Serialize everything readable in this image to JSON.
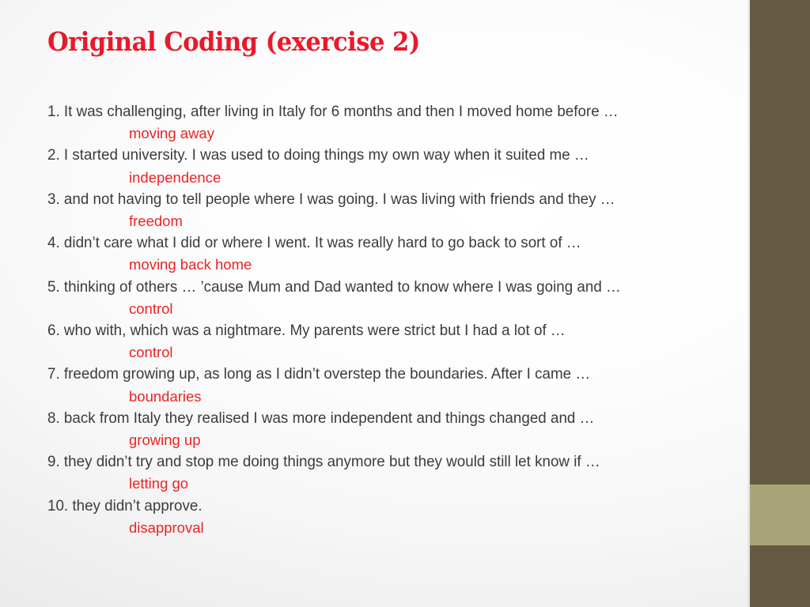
{
  "slide": {
    "title": "Original Coding (exercise 2)",
    "colors": {
      "title_red": "#e8192b",
      "code_red": "#ee2222",
      "body_text": "#3b3b3b",
      "band_dark": "#655b44",
      "band_accent": "#a9a378"
    }
  },
  "entries": [
    {
      "statement": "1. It was challenging, after living in Italy for 6 months and then I moved home before …",
      "code": "moving away"
    },
    {
      "statement": "2. I started university. I was used to doing things my own way when it suited me …",
      "code": "independence"
    },
    {
      "statement": "3. and not having to tell people where I was going. I was living with friends and they …",
      "code": "freedom"
    },
    {
      "statement": "4. didn’t care what I did or where I went. It was really hard to go back to sort of …",
      "code": "moving back home"
    },
    {
      "statement": "5. thinking of others … ’cause Mum and Dad wanted to know where I was going and …",
      "code": "control"
    },
    {
      "statement": "6. who with, which was a nightmare. My parents were strict but I had a lot of …",
      "code": "control"
    },
    {
      "statement": "7. freedom growing up, as long as I didn’t overstep the boundaries. After I came …",
      "code": "boundaries"
    },
    {
      "statement": "8. back from Italy they realised I was more independent and things changed and …",
      "code": "growing up"
    },
    {
      "statement": "9. they didn’t try and stop me doing things anymore but they would still let know if …",
      "code": "letting go"
    },
    {
      "statement": "10. they didn’t approve.",
      "code": "disapproval"
    }
  ]
}
